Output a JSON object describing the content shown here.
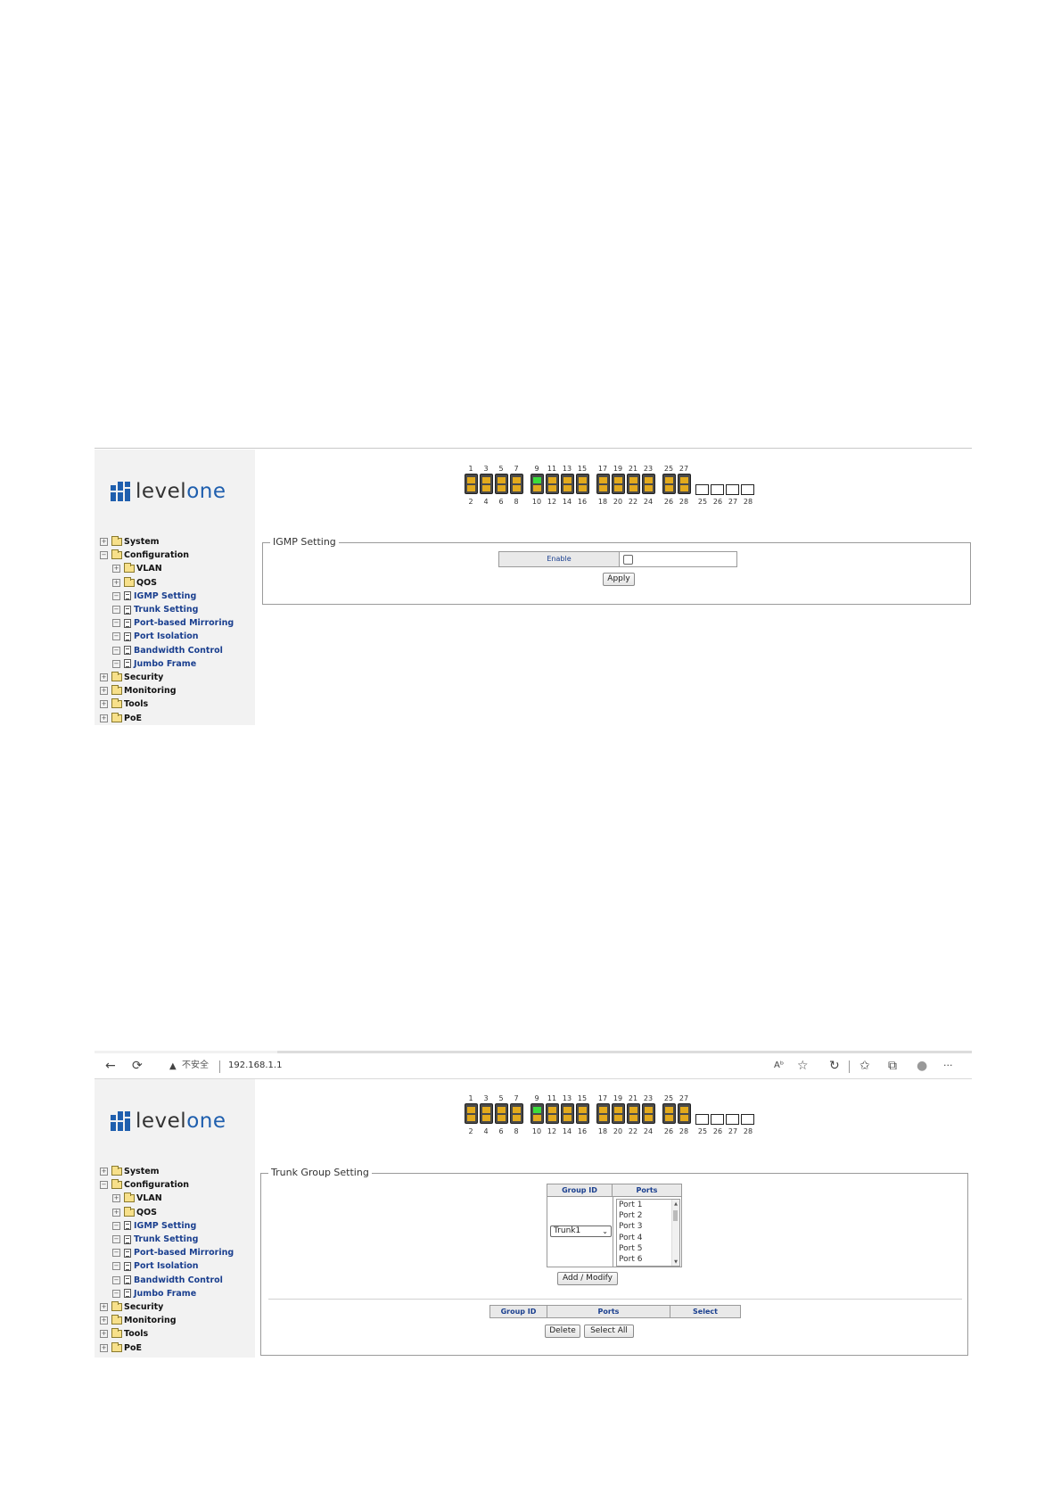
{
  "logo": {
    "word_dark": "level",
    "word_accent": "one",
    "brand_color": "#1f5fae"
  },
  "port_panel": {
    "top_labels": [
      "1",
      "3",
      "5",
      "7",
      "9",
      "11",
      "13",
      "15",
      "17",
      "19",
      "21",
      "23",
      "25",
      "27"
    ],
    "bottom_labels": [
      "2",
      "4",
      "6",
      "8",
      "10",
      "12",
      "14",
      "16",
      "18",
      "20",
      "22",
      "24",
      "26",
      "28"
    ],
    "sfp_labels": [
      "25",
      "26",
      "27",
      "28"
    ],
    "active_port": "9",
    "link_color": "#3bdc3b",
    "port_color": "#e2a91d"
  },
  "sidebar": {
    "items": [
      {
        "label": "System",
        "type": "folder",
        "expander": "+"
      },
      {
        "label": "Configuration",
        "type": "folder",
        "expander": "−"
      },
      {
        "label": "VLAN",
        "type": "folder",
        "expander": "+",
        "sub": true
      },
      {
        "label": "QOS",
        "type": "folder",
        "expander": "+",
        "sub": true
      },
      {
        "label": "IGMP Setting",
        "type": "page",
        "expander": "−",
        "sub": true
      },
      {
        "label": "Trunk Setting",
        "type": "page",
        "expander": "−",
        "sub": true
      },
      {
        "label": "Port-based Mirroring",
        "type": "page",
        "expander": "−",
        "sub": true
      },
      {
        "label": "Port Isolation",
        "type": "page",
        "expander": "−",
        "sub": true
      },
      {
        "label": "Bandwidth Control",
        "type": "page",
        "expander": "−",
        "sub": true
      },
      {
        "label": "Jumbo Frame",
        "type": "page",
        "expander": "−",
        "sub": true
      },
      {
        "label": "Security",
        "type": "folder",
        "expander": "+"
      },
      {
        "label": "Monitoring",
        "type": "folder",
        "expander": "+"
      },
      {
        "label": "Tools",
        "type": "folder",
        "expander": "+"
      },
      {
        "label": "PoE",
        "type": "folder",
        "expander": "+"
      }
    ]
  },
  "igmp": {
    "legend": "IGMP Setting",
    "enable_label": "Enable",
    "enabled": false,
    "apply_label": "Apply"
  },
  "browser": {
    "back_icon": "←",
    "reload_icon": "⟳",
    "security_icon": "▲",
    "security_text": "不安全",
    "address": "192.168.1.1",
    "right_icons": [
      "Aᵇ",
      "☆",
      "↻",
      "✩",
      "⧉",
      "●",
      "···"
    ]
  },
  "trunk": {
    "legend": "Trunk Group Setting",
    "col_group_id": "Group ID",
    "col_ports": "Ports",
    "selected_trunk": "Trunk1",
    "port_list": [
      "Port 1",
      "Port 2",
      "Port 3",
      "Port 4",
      "Port 5",
      "Port 6"
    ],
    "add_modify_label": "Add / Modify",
    "result_headers": [
      "Group ID",
      "Ports",
      "Select"
    ],
    "delete_label": "Delete",
    "select_all_label": "Select All"
  }
}
